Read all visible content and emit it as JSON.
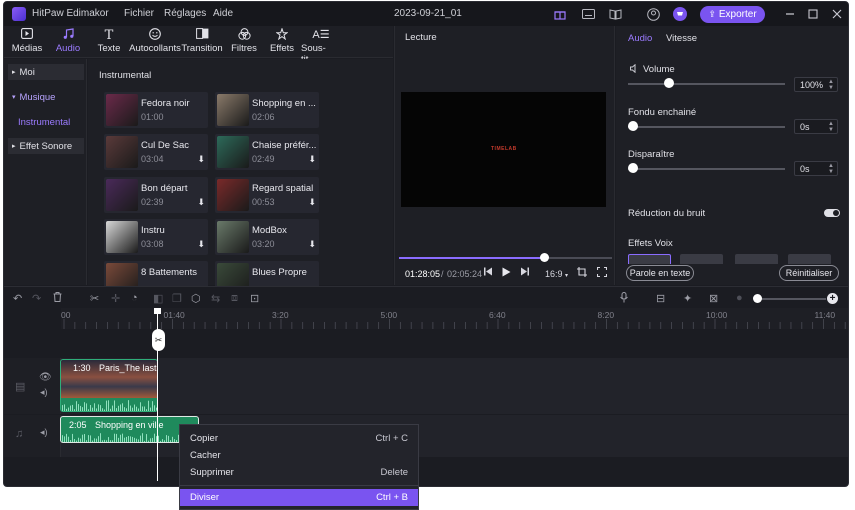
{
  "app": {
    "name": "HitPaw Edimakor",
    "menu": [
      "Fichier",
      "Réglages",
      "Aide"
    ],
    "project_title": "2023-09-21_01",
    "export_label": "Exporter"
  },
  "toolbar": {
    "tools": [
      {
        "label": "Médias",
        "icon": "media-icon"
      },
      {
        "label": "Audio",
        "icon": "music-note-icon"
      },
      {
        "label": "Texte",
        "icon": "text-icon"
      },
      {
        "label": "Autocollants",
        "icon": "sticker-icon"
      },
      {
        "label": "Transition",
        "icon": "transition-icon"
      },
      {
        "label": "Filtres",
        "icon": "filter-icon"
      },
      {
        "label": "Effets",
        "icon": "effects-icon"
      },
      {
        "label": "Sous-tit...",
        "icon": "subtitle-icon"
      }
    ],
    "active": "Audio"
  },
  "leftnav": {
    "items": [
      "Moi",
      "Musique",
      "Instrumental",
      "Effet Sonore"
    ]
  },
  "library": {
    "section_title": "Instrumental",
    "cards": [
      {
        "name": "Fedora noir",
        "duration": "01:00",
        "download": false,
        "color": "#6b2a4a"
      },
      {
        "name": "Shopping en ...",
        "duration": "02:06",
        "download": false,
        "color": "#8a7a6a"
      },
      {
        "name": "Cul De Sac",
        "duration": "03:04",
        "download": true,
        "color": "#5a3a3a"
      },
      {
        "name": "Chaise préfér...",
        "duration": "02:49",
        "download": true,
        "color": "#2d6a5a"
      },
      {
        "name": "Bon départ",
        "duration": "02:39",
        "download": true,
        "color": "#4a2a5a"
      },
      {
        "name": "Regard spatial",
        "duration": "00:53",
        "download": true,
        "color": "#7a2a2a"
      },
      {
        "name": "Instru",
        "duration": "03:08",
        "download": true,
        "color": "#d8d8d8"
      },
      {
        "name": "ModBox",
        "duration": "03:20",
        "download": true,
        "color": "#6a7a6a"
      },
      {
        "name": "8 Battements",
        "duration": "",
        "download": false,
        "color": "#7a4a3a"
      },
      {
        "name": "Blues Propre",
        "duration": "",
        "download": false,
        "color": "#3a4a3a"
      }
    ]
  },
  "player": {
    "title": "Lecture",
    "screen_text": "TIMELAB",
    "current_time": "01:28:05",
    "separator": "/",
    "total_time": "02:05:24",
    "aspect": "16:9",
    "progress_pct": 68
  },
  "right_panel": {
    "tabs": [
      "Audio",
      "Vitesse"
    ],
    "volume_label": "Volume",
    "volume_value": "100%",
    "volume_pct": 0.26,
    "fade_in_label": "Fondu enchainé",
    "fade_in_value": "0s",
    "fade_out_label": "Disparaître",
    "fade_out_value": "0s",
    "noise_label": "Réduction du bruit",
    "voice_label": "Effets Voix",
    "text_to_speech": "Parole en texte",
    "reset": "Réinitialiser"
  },
  "timeline": {
    "ticks": [
      "00",
      "01:40",
      "3:20",
      "5:00",
      "6:40",
      "8:20",
      "10:00",
      "11:40"
    ],
    "video_clip": {
      "duration": "1:30",
      "name": "Paris_The last"
    },
    "audio_clip": {
      "duration": "2:05",
      "name": "Shopping en ville"
    }
  },
  "context_menu": {
    "items": [
      {
        "label": "Copier",
        "shortcut": "Ctrl + C"
      },
      {
        "label": "Cacher",
        "shortcut": ""
      },
      {
        "label": "Supprimer",
        "shortcut": "Delete"
      },
      {
        "label": "Diviser",
        "shortcut": "Ctrl + B"
      }
    ],
    "highlighted": "Diviser"
  },
  "colors": {
    "accent": "#7a54f0",
    "clip_green": "#1f8a5c",
    "background": "#1e1f25"
  }
}
